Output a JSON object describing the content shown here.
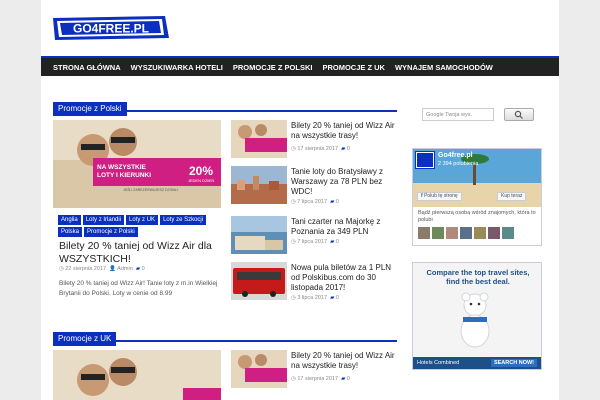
{
  "site": {
    "logo_text": "GO4FREE.PL"
  },
  "nav": [
    "STRONA GŁÓWNA",
    "WYSZUKIWARKA HOTELI",
    "PROMOCJE Z POLSKI",
    "PROMOCJE Z UK",
    "WYNAJEM SAMOCHODÓW"
  ],
  "section_polska": {
    "title": "Promocje z Polski",
    "featured": {
      "banner_line": "NA WSZYSTKIE",
      "banner_line2": "LOTY I KIERUNKI",
      "banner_percent": "20%",
      "banner_sub": "JEDEN DZIEŃ",
      "banner_small": "JEŚLI ZAREZERWUJESZ DZISIAJ",
      "tags": [
        "Anglia",
        "Loty z Irlandii",
        "Loty z UK",
        "Loty ze Szkocji",
        "Polska",
        "Promocje z Polski"
      ],
      "title": "Bilety 20 % taniej od Wizz Air dla WSZYSTKICH!",
      "date": "22 sierpnia 2017",
      "author": "Admin",
      "comments": "0",
      "excerpt": "Bilety 20 % taniej od Wizz Air! Tanie loty z m.in Wielkiej Brytanii do Polski. Loty w cenie od 8.99"
    },
    "list": [
      {
        "title": "Bilety 20 % taniej od Wizz Air na wszystkie trasy!",
        "date": "17 sierpnia 2017",
        "comments": "0",
        "thumb": "wizz"
      },
      {
        "title": "Tanie loty do Bratysławy z Warszawy za 78 PLN bez WDC!",
        "date": "7 lipca 2017",
        "comments": "0",
        "thumb": "city"
      },
      {
        "title": "Tani czarter na Majorkę z Poznania za 349 PLN",
        "date": "7 lipca 2017",
        "comments": "0",
        "thumb": "coast"
      },
      {
        "title": "Nowa pula biletów za 1 PLN od Polskibus.com do 30 listopada 2017!",
        "date": "3 lipca 2017",
        "comments": "0",
        "thumb": "bus"
      }
    ]
  },
  "section_uk": {
    "title": "Promocje z UK",
    "list": [
      {
        "title": "Bilety 20 % taniej od Wizz Air na wszystkie trasy!",
        "date": "17 sierpnia 2017",
        "comments": "0"
      }
    ]
  },
  "sidebar": {
    "search_placeholder": "Google Twoja wys.",
    "fb": {
      "page_name": "Go4free.pl",
      "likes": "2 394 polubienia",
      "like_button": "Polub tę stronę",
      "share_button": "Kup teraz",
      "friends_text": "Bądź pierwszą osobą wśród znajomych, która to polubi"
    },
    "ad": {
      "headline": "Compare the top travel sites, find the best deal.",
      "brand": "Hotels Combined",
      "cta": "SEARCH NOW!"
    }
  },
  "colors": {
    "accent": "#0b2fbf",
    "nav_bg": "#222222",
    "banner_pink": "#cf1f83"
  }
}
